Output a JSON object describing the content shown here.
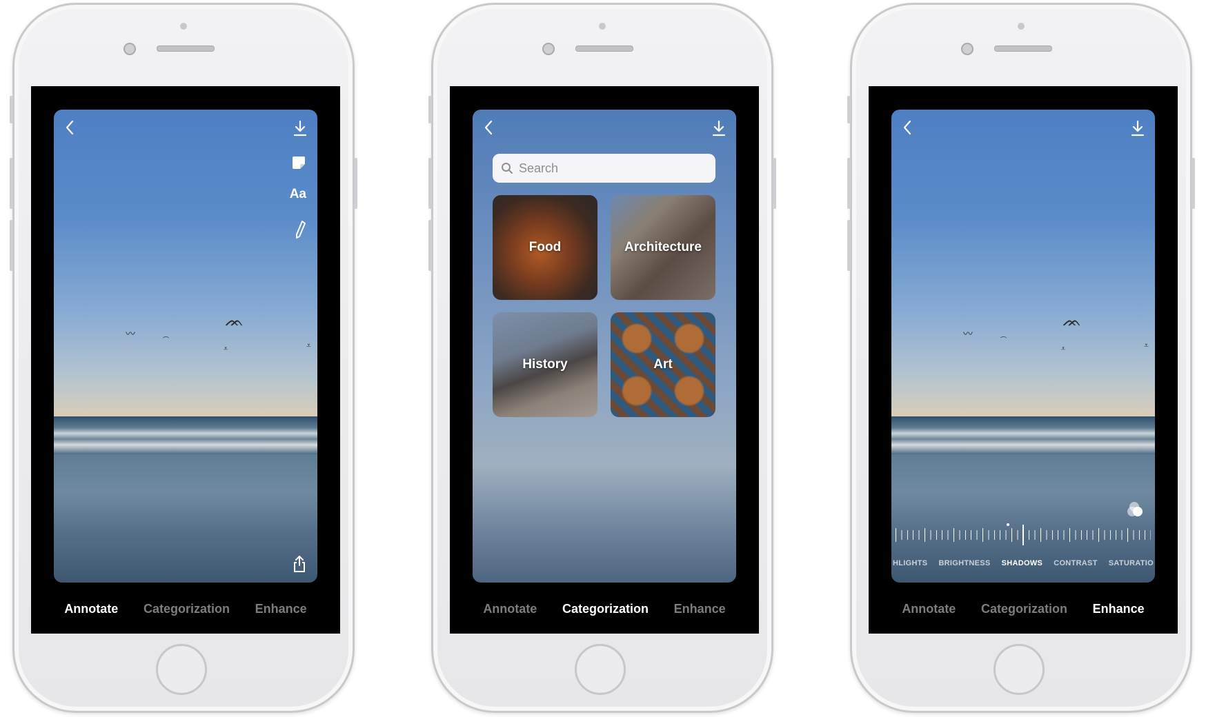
{
  "screens": [
    {
      "id": "annotate",
      "tools": {
        "text_tool_label": "Aa"
      },
      "tabs": [
        {
          "label": "Annotate",
          "active": true
        },
        {
          "label": "Categorization",
          "active": false
        },
        {
          "label": "Enhance",
          "active": false
        }
      ]
    },
    {
      "id": "categorization",
      "search": {
        "placeholder": "Search"
      },
      "categories": [
        {
          "label": "Food"
        },
        {
          "label": "Architecture"
        },
        {
          "label": "History"
        },
        {
          "label": "Art"
        }
      ],
      "tabs": [
        {
          "label": "Annotate",
          "active": false
        },
        {
          "label": "Categorization",
          "active": true
        },
        {
          "label": "Enhance",
          "active": false
        }
      ]
    },
    {
      "id": "enhance",
      "adjustments": [
        {
          "label": "HLIGHTS",
          "active": false
        },
        {
          "label": "BRIGHTNESS",
          "active": false
        },
        {
          "label": "SHADOWS",
          "active": true
        },
        {
          "label": "CONTRAST",
          "active": false
        },
        {
          "label": "SATURATIO",
          "active": false
        }
      ],
      "tabs": [
        {
          "label": "Annotate",
          "active": false
        },
        {
          "label": "Categorization",
          "active": false
        },
        {
          "label": "Enhance",
          "active": true
        }
      ]
    }
  ],
  "icons": {
    "back": "chevron-left-icon",
    "download": "download-icon",
    "note": "note-icon",
    "pen": "pen-icon",
    "share": "share-icon",
    "search": "search-icon",
    "filter": "filter-icon"
  },
  "colors": {
    "active_tab": "#ffffff",
    "inactive_tab": "#7d7d7d",
    "phone_body": "#ececee",
    "screen_bg": "#000000"
  }
}
